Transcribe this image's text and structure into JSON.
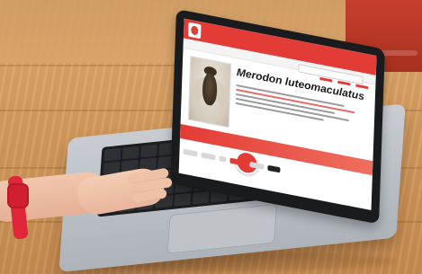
{
  "photo": {
    "subject": "laptop-on-wooden-desk",
    "screen": {
      "page_title": "Merodon luteomaculatus",
      "accent_color": "#e33b35"
    },
    "props": {
      "watch_color": "#d11f32",
      "wood_color": "#d39a5d"
    }
  }
}
